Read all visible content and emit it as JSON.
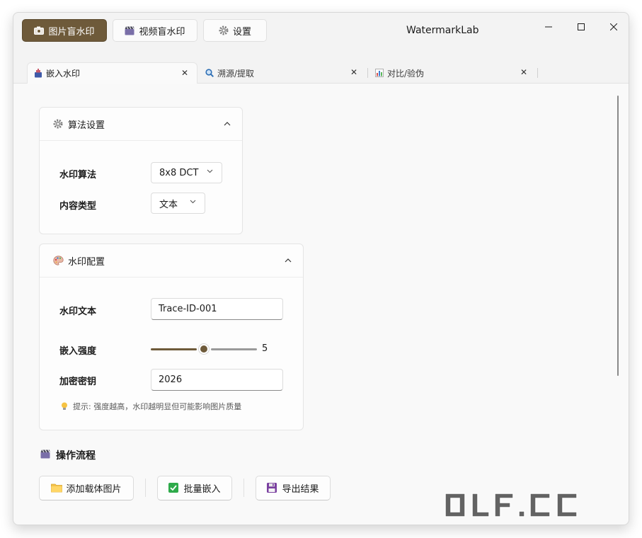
{
  "app": {
    "title": "WatermarkLab"
  },
  "modes": [
    {
      "label": "图片盲水印",
      "icon": "camera-icon",
      "active": true
    },
    {
      "label": "视频盲水印",
      "icon": "clapper-icon",
      "active": false
    },
    {
      "label": "设置",
      "icon": "gear-icon",
      "active": false
    }
  ],
  "window_controls": {
    "minimize": "—",
    "maximize": "☐",
    "close": "✕"
  },
  "tabs": [
    {
      "label": "嵌入水印",
      "icon": "ink-icon",
      "active": true,
      "close": "✕"
    },
    {
      "label": "溯源/提取",
      "icon": "magnifier-icon",
      "active": false,
      "close": "✕"
    },
    {
      "label": "对比/验伪",
      "icon": "bar-chart-icon",
      "active": false,
      "close": "✕"
    }
  ],
  "algo_card": {
    "title": "算法设置",
    "icon": "gear-icon",
    "rows": [
      {
        "label": "水印算法",
        "value": "8x8 DCT"
      },
      {
        "label": "内容类型",
        "value": "文本"
      }
    ]
  },
  "config_card": {
    "title": "水印配置",
    "icon": "palette-icon",
    "text_label": "水印文本",
    "text_value": "Trace-ID-001",
    "strength_label": "嵌入强度",
    "strength_value": "5",
    "strength_min": 0,
    "strength_max": 10,
    "key_label": "加密密钥",
    "key_value": "2026",
    "hint": "提示: 强度越高，水印越明显但可能影响图片质量"
  },
  "workflow": {
    "title": "操作流程",
    "buttons": [
      {
        "label": "添加载体图片",
        "icon": "folder-icon"
      },
      {
        "label": "批量嵌入",
        "icon": "check-icon"
      },
      {
        "label": "导出结果",
        "icon": "floppy-icon"
      }
    ]
  },
  "site_watermark": "OLF.CC",
  "colors": {
    "accent": "#6e5a3a",
    "window_bg": "#f3f3f3",
    "card_bg": "#fdfdfd"
  }
}
